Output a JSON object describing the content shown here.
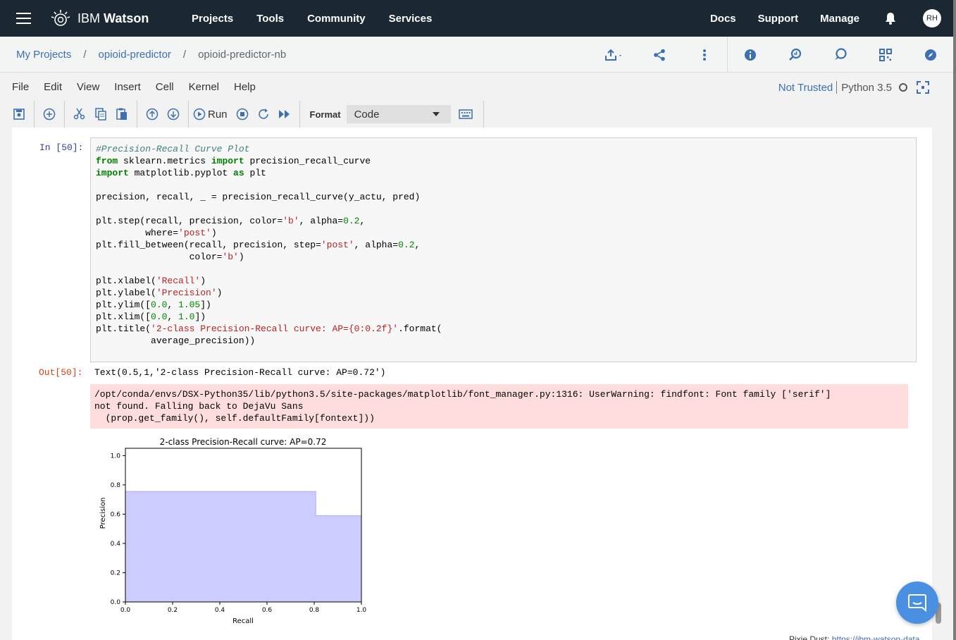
{
  "topbar": {
    "brand_prefix": "IBM",
    "brand_name": "Watson",
    "nav": [
      "Projects",
      "Tools",
      "Community",
      "Services"
    ],
    "right_nav": [
      "Docs",
      "Support",
      "Manage"
    ],
    "avatar_initials": "RH"
  },
  "breadcrumb": {
    "items": [
      "My Projects",
      "opioid-predictor"
    ],
    "current": "opioid-predictor-nb",
    "separator": "/"
  },
  "menubar": {
    "items": [
      "File",
      "Edit",
      "View",
      "Insert",
      "Cell",
      "Kernel",
      "Help"
    ],
    "trust_status": "Not Trusted",
    "kernel_name": "Python 3.5"
  },
  "toolbar": {
    "run_label": "Run",
    "format_label": "Format",
    "format_value": "Code"
  },
  "cell": {
    "in_prompt": "In [50]:",
    "out_prompt": "Out[50]:",
    "out_text": "Text(0.5,1,'2-class Precision-Recall curve: AP=0.72')",
    "stderr": "/opt/conda/envs/DSX-Python35/lib/python3.5/site-packages/matplotlib/font_manager.py:1316: UserWarning: findfont: Font family ['serif']\nnot found. Falling back to DejaVu Sans\n  (prop.get_family(), self.defaultFamily[fontext]))"
  },
  "chart_data": {
    "type": "area",
    "title": "2-class Precision-Recall curve: AP=0.72",
    "xlabel": "Recall",
    "ylabel": "Precision",
    "xlim": [
      0.0,
      1.0
    ],
    "ylim": [
      0.0,
      1.05
    ],
    "x_ticks": [
      "0.0",
      "0.2",
      "0.4",
      "0.6",
      "0.8",
      "1.0"
    ],
    "y_ticks": [
      "0.0",
      "0.2",
      "0.4",
      "0.6",
      "0.8",
      "1.0"
    ],
    "x": [
      0.0,
      0.807,
      0.807,
      1.0
    ],
    "y": [
      0.755,
      0.755,
      0.59,
      0.59
    ],
    "color": "#0000ff",
    "alpha": 0.2,
    "step": "post"
  },
  "footer_peek": {
    "text": "Pixie Dust:",
    "link": "https://ibm-watson-data"
  }
}
